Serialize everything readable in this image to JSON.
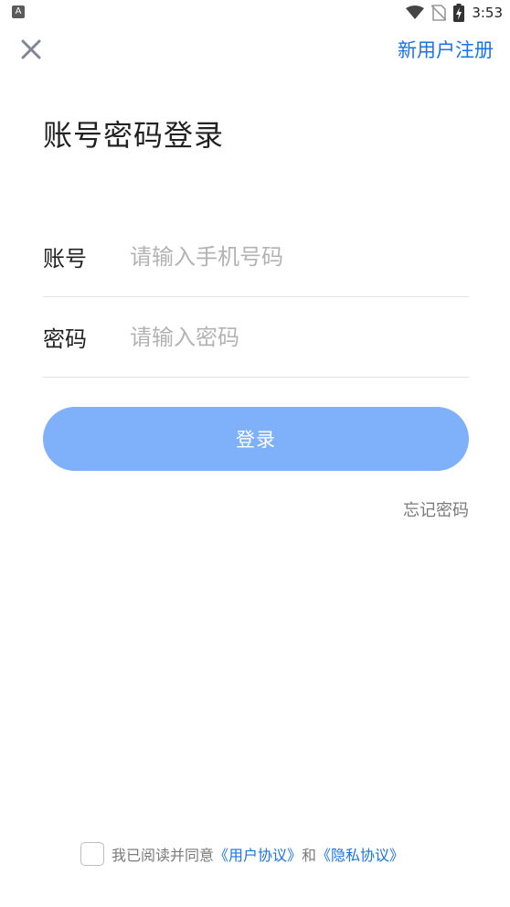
{
  "status_bar": {
    "left_icon_label": "A",
    "time": "3:53",
    "icons": [
      "wifi-icon",
      "no-sim-icon",
      "battery-charging-icon"
    ]
  },
  "top_bar": {
    "close_icon": "close-icon",
    "register_label": "新用户注册"
  },
  "title": "账号密码登录",
  "form": {
    "account": {
      "label": "账号",
      "placeholder": "请输入手机号码",
      "value": ""
    },
    "password": {
      "label": "密码",
      "placeholder": "请输入密码",
      "value": ""
    }
  },
  "login_button_label": "登录",
  "forgot_password_label": "忘记密码",
  "agreement": {
    "prefix": "我已阅读并同意",
    "user_agreement": "《用户协议》",
    "conjunction": "和",
    "privacy_agreement": "《隐私协议》",
    "checked": false
  },
  "colors": {
    "accent": "#1a73e8",
    "login_button": "#7fb1fb",
    "placeholder": "#b3b3b3",
    "divider": "#e4e4e4"
  }
}
